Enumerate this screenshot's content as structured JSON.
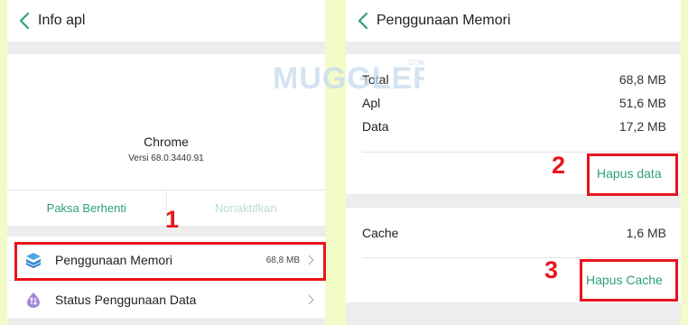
{
  "left": {
    "title": "Info apl",
    "app_name": "Chrome",
    "app_version": "Versi 68.0.3440.91",
    "force_stop": "Paksa Berhenti",
    "disable": "Nonaktifkan",
    "items": [
      {
        "label": "Penggunaan Memori",
        "value": "68,8 MB",
        "icon": "layers-icon"
      },
      {
        "label": "Status Penggunaan Data",
        "icon": "data-drop-icon"
      }
    ]
  },
  "right": {
    "title": "Penggunaan Memori",
    "stats": [
      {
        "label": "Total",
        "value": "68,8 MB"
      },
      {
        "label": "Apl",
        "value": "51,6 MB"
      },
      {
        "label": "Data",
        "value": "17,2 MB"
      }
    ],
    "clear_data": "Hapus data",
    "cache_label": "Cache",
    "cache_value": "1,6 MB",
    "clear_cache": "Hapus Cache"
  },
  "annotations": {
    "step1": "1",
    "step2": "2",
    "step3": "3",
    "color": "#e8151c"
  },
  "watermark": {
    "brand": "MUGGLER",
    "suffix": ".COM"
  },
  "colors": {
    "accent": "#2e9f78",
    "background": "#f3fbc8"
  }
}
